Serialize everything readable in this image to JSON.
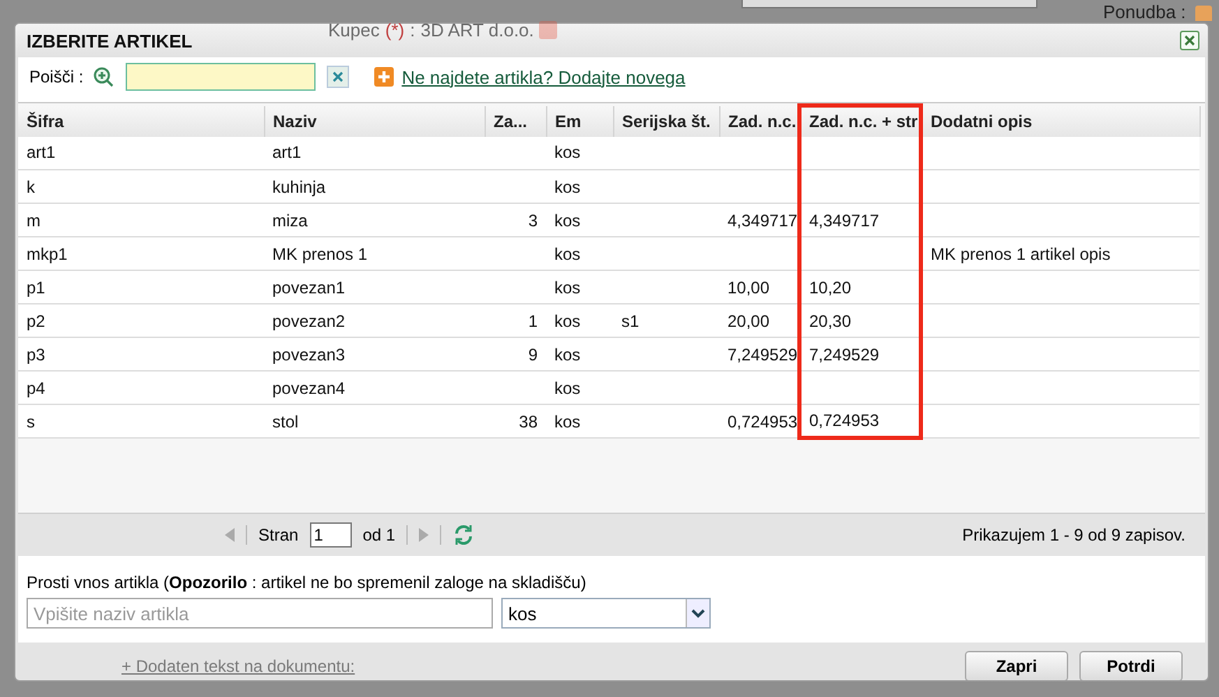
{
  "background": {
    "customer_label": "Kupec",
    "customer_required": "(*)",
    "customer_sep": ":",
    "customer_value": "3D ART d.o.o.",
    "offer_label": "Ponudba :"
  },
  "dialog": {
    "title": "IZBERITE ARTIKEL"
  },
  "search": {
    "label": "Poišči :",
    "add_link": "Ne najdete artikla? Dodajte novega"
  },
  "table": {
    "columns": [
      {
        "label": "Šifra",
        "highlighted": false
      },
      {
        "label": "Naziv",
        "highlighted": false
      },
      {
        "label": "Za...",
        "highlighted": false
      },
      {
        "label": "Em",
        "highlighted": false
      },
      {
        "label": "Serijska št.",
        "highlighted": false
      },
      {
        "label": "Zad. n.c.",
        "highlighted": false
      },
      {
        "label": "Zad. n.c. + str",
        "highlighted": true
      },
      {
        "label": "Dodatni opis",
        "highlighted": false
      }
    ],
    "rows": [
      [
        "art1",
        "art1",
        "",
        "kos",
        "",
        "",
        "",
        ""
      ],
      [
        "k",
        "kuhinja",
        "",
        "kos",
        "",
        "",
        "",
        ""
      ],
      [
        "m",
        "miza",
        "3",
        "kos",
        "",
        "4,349717",
        "4,349717",
        ""
      ],
      [
        "mkp1",
        "MK prenos 1",
        "",
        "kos",
        "",
        "",
        "",
        "MK prenos 1 artikel opis"
      ],
      [
        "p1",
        "povezan1",
        "",
        "kos",
        "",
        "10,00",
        "10,20",
        ""
      ],
      [
        "p2",
        "povezan2",
        "1",
        "kos",
        "s1",
        "20,00",
        "20,30",
        ""
      ],
      [
        "p3",
        "povezan3",
        "9",
        "kos",
        "",
        "7,249529",
        "7,249529",
        ""
      ],
      [
        "p4",
        "povezan4",
        "",
        "kos",
        "",
        "",
        "",
        ""
      ],
      [
        "s",
        "stol",
        "38",
        "kos",
        "",
        "0,724953",
        "0,724953",
        ""
      ]
    ]
  },
  "pager": {
    "page_label": "Stran",
    "page": "1",
    "of_label": "od 1",
    "summary": "Prikazujem 1 - 9 od 9 zapisov."
  },
  "simple_entry": {
    "caption": "Prosti vnos artikla (**Opozorilo** : artikel ne bo spremenil zaloge na skladišču)",
    "placeholder": "Vpišite naziv artikla",
    "unit": "kos"
  },
  "footer": {
    "link": "+ Dodaten tekst na dokumentu:",
    "buttons": [
      "Zapri",
      "Potrdi"
    ]
  }
}
